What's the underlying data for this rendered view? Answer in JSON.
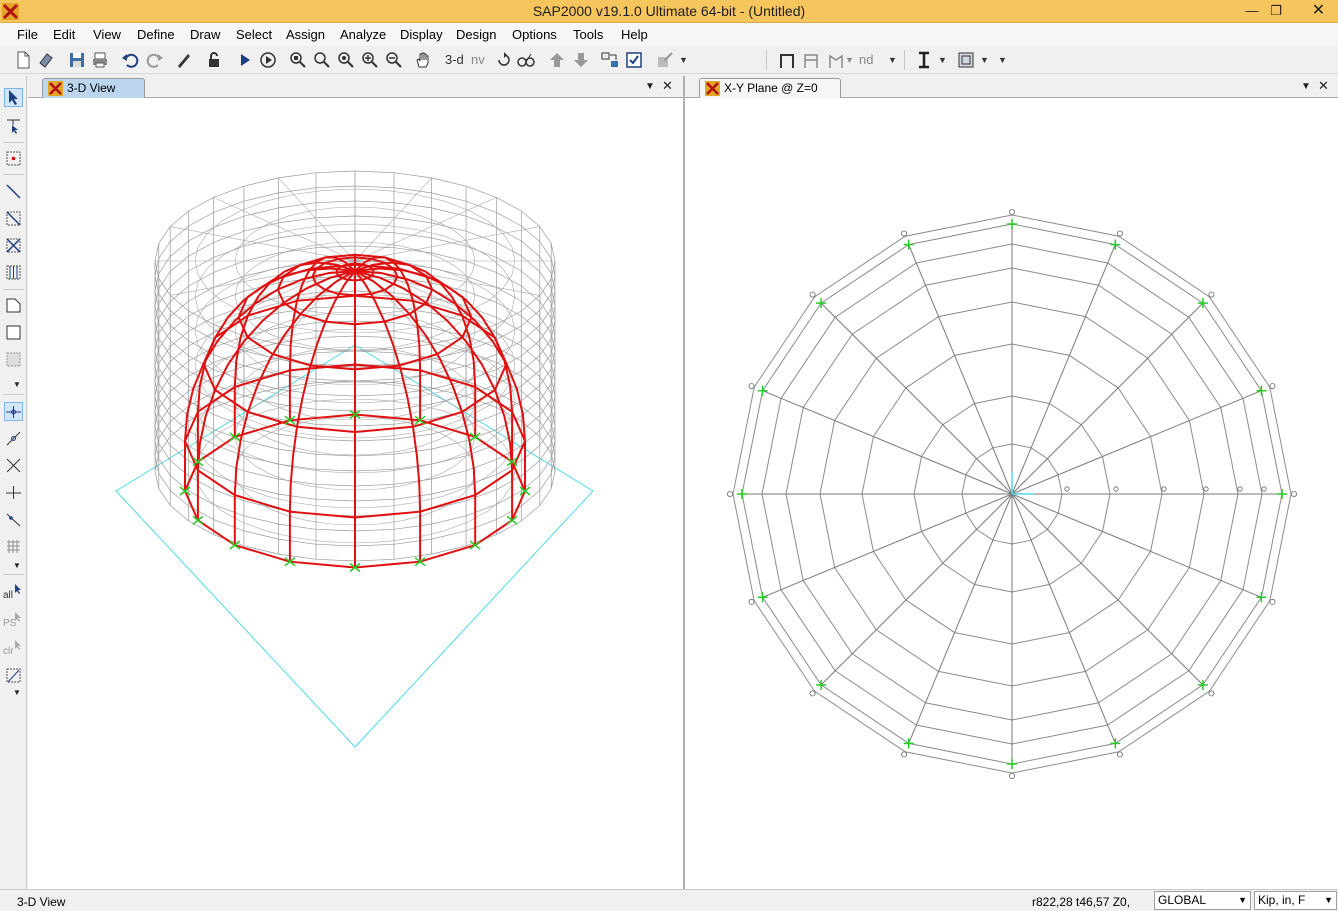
{
  "window": {
    "title": "SAP2000 v19.1.0 Ultimate 64-bit - (Untitled)"
  },
  "menu": [
    "File",
    "Edit",
    "View",
    "Define",
    "Draw",
    "Select",
    "Assign",
    "Analyze",
    "Display",
    "Design",
    "Options",
    "Tools",
    "Help"
  ],
  "toolbar": {
    "view3d_label": "3-d",
    "nv_label": "nv",
    "nd_label": "nd"
  },
  "lefttools": {
    "all_label": "all",
    "ps_label": "PS",
    "clr_label": "clr"
  },
  "panes": {
    "left": {
      "tab_label": "3-D View"
    },
    "right": {
      "tab_label": "X-Y Plane @ Z=0"
    }
  },
  "status": {
    "text": "3-D View",
    "coords": "r822,28  t46,57  Z0,",
    "coord_system": "GLOBAL",
    "units": "Kip, in, F"
  },
  "colors": {
    "frame_gray": "#8c8c8c",
    "dome_red": "#e01010",
    "support_green": "#22cc22",
    "grid_cyan": "#4fd9e8",
    "title_bar": "#f6c55d",
    "active_tab": "#bcd6f0"
  }
}
